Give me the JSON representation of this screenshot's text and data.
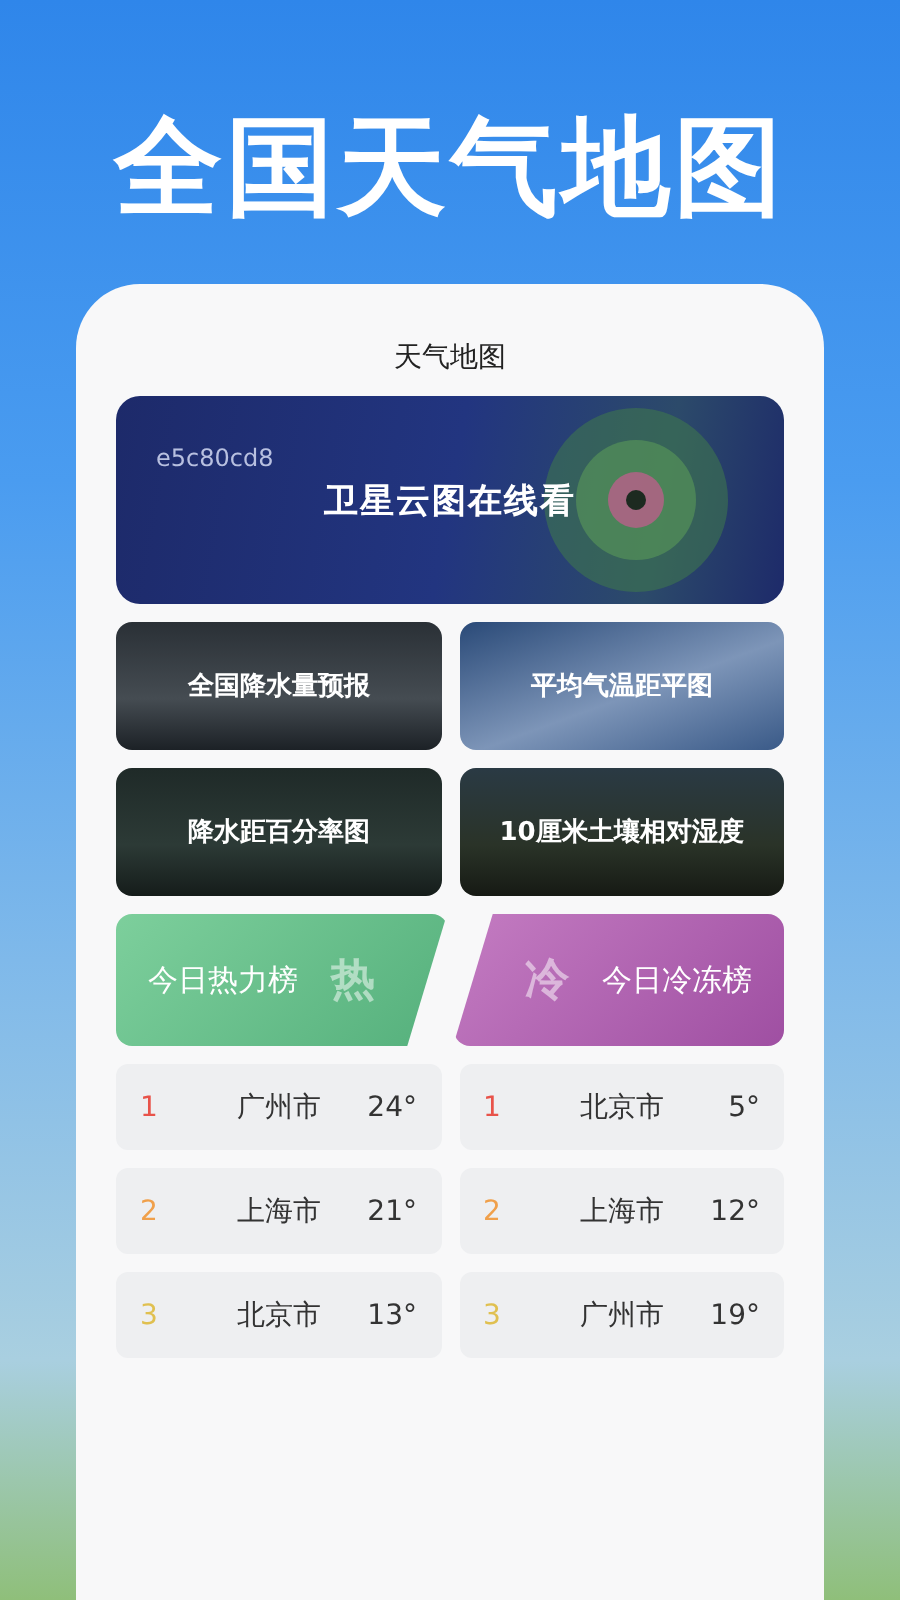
{
  "headline": "全国天气地图",
  "screen_title": "天气地图",
  "banner": {
    "code": "e5c80cd8",
    "label": "卫星云图在线看"
  },
  "tiles": [
    {
      "label": "全国降水量预报",
      "kind": "rain"
    },
    {
      "label": "平均气温距平图",
      "kind": "sky"
    },
    {
      "label": "降水距百分率图",
      "kind": "drops"
    },
    {
      "label": "10厘米土壤相对湿度",
      "kind": "soil"
    }
  ],
  "rankings": [
    {
      "title": "今日热力榜",
      "mark": "热",
      "kind": "hot",
      "rows": [
        {
          "rank": "1",
          "city": "广州市",
          "temp": "24°",
          "color": "#e8534a"
        },
        {
          "rank": "2",
          "city": "上海市",
          "temp": "21°",
          "color": "#f0a04b"
        },
        {
          "rank": "3",
          "city": "北京市",
          "temp": "13°",
          "color": "#e0c050"
        }
      ]
    },
    {
      "title": "今日冷冻榜",
      "mark": "冷",
      "kind": "cold",
      "rows": [
        {
          "rank": "1",
          "city": "北京市",
          "temp": "5°",
          "color": "#e8534a"
        },
        {
          "rank": "2",
          "city": "上海市",
          "temp": "12°",
          "color": "#f0a04b"
        },
        {
          "rank": "3",
          "city": "广州市",
          "temp": "19°",
          "color": "#e0c050"
        }
      ]
    }
  ]
}
